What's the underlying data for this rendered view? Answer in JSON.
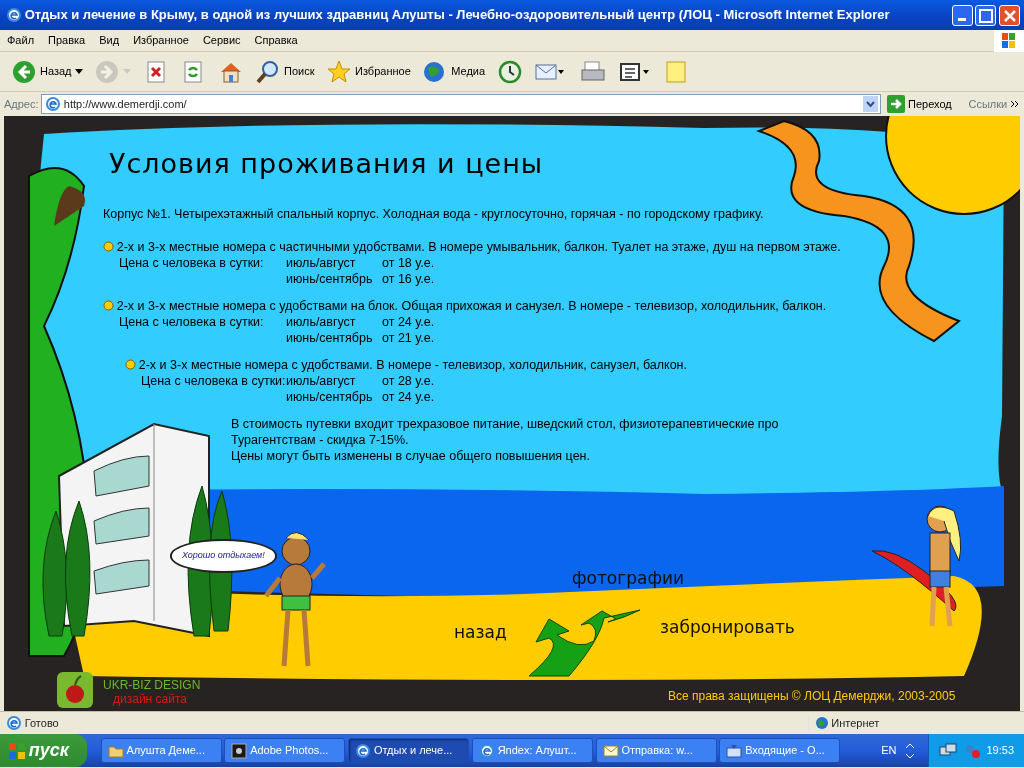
{
  "window": {
    "title": "Отдых и лечение в Крыму, в одной из лучших здравниц Алушты - Лечебно-оздоровительный центр (ЛОЦ - Microsoft Internet Explorer"
  },
  "menu": [
    "Файл",
    "Правка",
    "Вид",
    "Избранное",
    "Сервис",
    "Справка"
  ],
  "toolbar": [
    {
      "kind": "back",
      "label": "Назад",
      "disabled": false
    },
    {
      "kind": "forward",
      "disabled": true
    },
    {
      "kind": "stop",
      "disabled": false
    },
    {
      "kind": "refresh",
      "disabled": false
    },
    {
      "kind": "home",
      "disabled": false
    },
    {
      "kind": "search",
      "label": "Поиск",
      "disabled": false
    },
    {
      "kind": "favorites",
      "label": "Избранное",
      "disabled": false
    },
    {
      "kind": "media",
      "label": "Медиа",
      "disabled": false
    },
    {
      "kind": "history",
      "disabled": false
    },
    {
      "kind": "mail",
      "disabled": false
    },
    {
      "kind": "print",
      "disabled": false
    },
    {
      "kind": "edit",
      "disabled": false
    },
    {
      "kind": "note",
      "disabled": false
    }
  ],
  "address_bar": {
    "label": "Адрес:",
    "url": "http://www.demerdji.com/",
    "go": "Переход",
    "links": "Ссылки"
  },
  "page": {
    "heading": "Условия проживания и цены",
    "intro": "Корпус №1. Четырехэтажный спальный корпус. Холодная вода - круглосуточно, горячая - по городскому графику.",
    "rooms": [
      {
        "description": "2-х и 3-х местные номера с частичными удобствами. В номере умывальник, балкон. Туалет на этаже, душ на первом этаже.",
        "indented": false,
        "price_label": "Цена с человека в сутки:",
        "prices": [
          {
            "period": "июль/август",
            "price": "от 18 у.е."
          },
          {
            "period": "июнь/сентябрь",
            "price": "от 16 у.е."
          }
        ]
      },
      {
        "description": "2-х и 3-х местные номера с удобствами на блок. Общая прихожая и санузел. В номере - телевизор, холодильник, балкон.",
        "indented": false,
        "price_label": "Цена с человека в сутки:",
        "prices": [
          {
            "period": "июль/август",
            "price": "от 24 у.е."
          },
          {
            "period": "июнь/сентябрь",
            "price": "от 21 у.е."
          }
        ]
      },
      {
        "description": "2-х и 3-х местные номера с удобствами. В номере - телевизор, холодильник, санузел, балкон.",
        "indented": true,
        "price_label": "Цена с человека в сутки:",
        "prices": [
          {
            "period": "июль/август",
            "price": "от 28 у.е."
          },
          {
            "period": "июнь/сентябрь",
            "price": "от 24 у.е."
          }
        ]
      }
    ],
    "notes": [
      "В стоимость путевки входит трехразовое питание, шведский стол, физиотерапевтические про",
      "Турагентствам - скидка 7-15%.",
      "Цены могут быть изменены в случае общего повышения цен."
    ],
    "speech_bubble": "Хорошо отдыхаем!",
    "nav_links": [
      {
        "kind": "photos",
        "label": "фотографии"
      },
      {
        "kind": "back",
        "label": "назад"
      },
      {
        "kind": "book",
        "label": "забронировать"
      }
    ],
    "footer": {
      "designer": "UKR-BIZ DESIGN",
      "designer_sub": "дизайн сайта",
      "copyright": "Все права защищены © ЛОЦ Демерджи, 2003-2005"
    }
  },
  "status_bar": {
    "text": "Готово",
    "zone": "Интернет"
  },
  "taskbar": {
    "start": "пуск",
    "tasks": [
      {
        "label": "Алушта Деме...",
        "kind": "folder",
        "selected": false
      },
      {
        "label": "Adobe Photos...",
        "kind": "photoshop",
        "selected": false
      },
      {
        "label": "Отдых и лече...",
        "kind": "ie",
        "selected": true
      },
      {
        "label": "Яndex: Алушт...",
        "kind": "ie",
        "selected": false
      },
      {
        "label": "Отправка: w...",
        "kind": "mail",
        "selected": false
      },
      {
        "label": "Входящие - О...",
        "kind": "outlook",
        "selected": false
      }
    ],
    "lang": "EN",
    "clock": "19:53"
  }
}
